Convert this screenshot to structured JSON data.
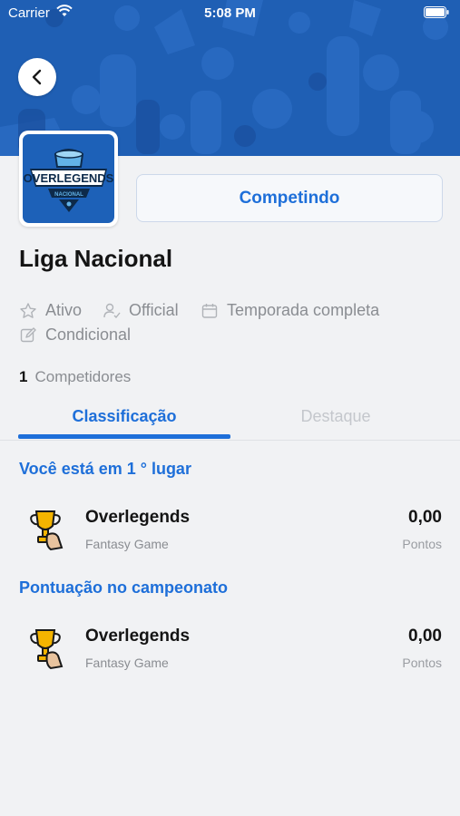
{
  "status_bar": {
    "carrier": "Carrier",
    "time": "5:08 PM"
  },
  "league": {
    "logo_text_main": "OVERLEGENDS",
    "logo_text_sub": "NACIONAL",
    "name": "Liga Nacional",
    "action_button": "Competindo",
    "meta": {
      "status": "Ativo",
      "type": "Official",
      "season": "Temporada completa",
      "rule": "Condicional"
    },
    "competitors_count": "1",
    "competitors_label": "Competidores"
  },
  "tabs": [
    {
      "label": "Classificação",
      "active": true
    },
    {
      "label": "Destaque",
      "active": false
    }
  ],
  "sections": [
    {
      "heading": "Você está em 1 ° lugar",
      "rows": [
        {
          "name": "Overlegends",
          "subtitle": "Fantasy Game",
          "score": "0,00",
          "unit": "Pontos"
        }
      ]
    },
    {
      "heading": "Pontuação no campeonato",
      "rows": [
        {
          "name": "Overlegends",
          "subtitle": "Fantasy Game",
          "score": "0,00",
          "unit": "Pontos"
        }
      ]
    }
  ],
  "colors": {
    "accent": "#1e6fd9",
    "banner": "#1f5fb4",
    "background": "#f1f2f4",
    "muted": "#8a8d92"
  },
  "icons": [
    "back-chevron-icon",
    "star-icon",
    "user-check-icon",
    "calendar-icon",
    "edit-icon",
    "trophy-icon",
    "wifi-icon",
    "battery-icon"
  ]
}
